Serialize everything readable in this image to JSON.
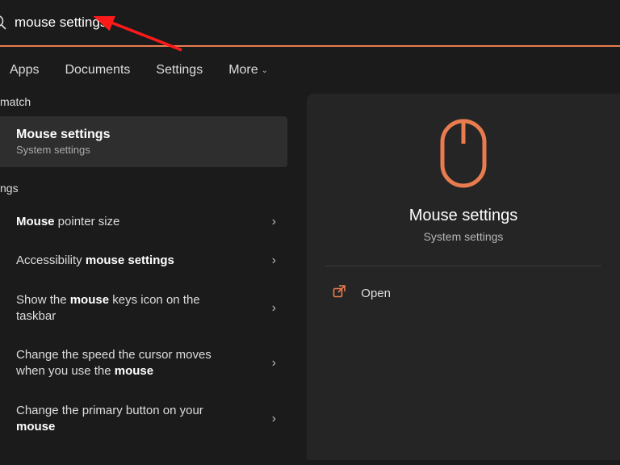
{
  "search": {
    "value": "mouse settings"
  },
  "tabs": [
    "Apps",
    "Documents",
    "Settings",
    "More"
  ],
  "sections": {
    "best_match_header": "match",
    "settings_header": "ngs"
  },
  "best_match": {
    "title": "Mouse settings",
    "subtitle": "System settings"
  },
  "settings_results": [
    {
      "html": "<b>Mouse</b> pointer size"
    },
    {
      "html": "Accessibility <b>mouse settings</b>"
    },
    {
      "html": "Show the <b>mouse</b> keys icon on the taskbar"
    },
    {
      "html": "Change the speed the cursor moves when you use the <b>mouse</b>"
    },
    {
      "html": "Change the primary button on your <b>mouse</b>"
    }
  ],
  "preview": {
    "title": "Mouse settings",
    "subtitle": "System settings",
    "action": "Open"
  },
  "colors": {
    "accent": "#e97c4f"
  }
}
